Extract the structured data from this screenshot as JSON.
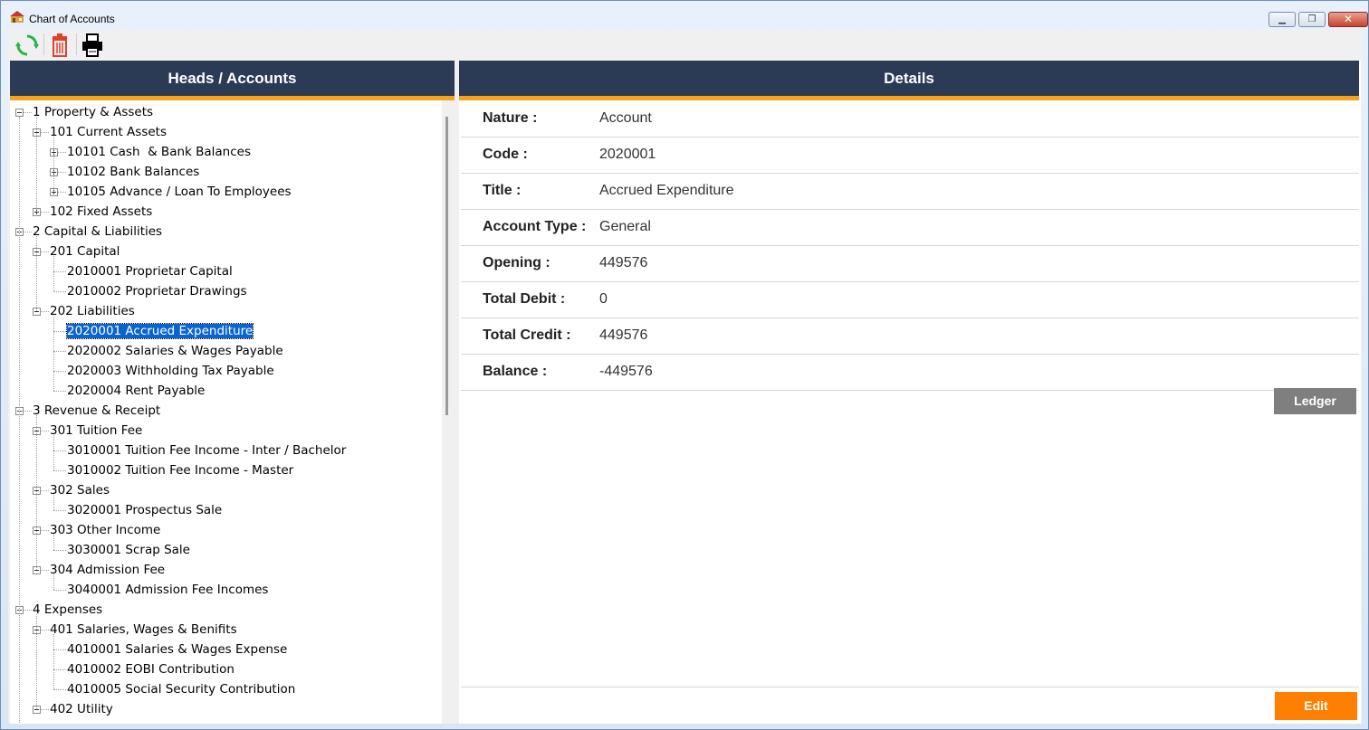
{
  "window": {
    "title": "Chart of Accounts"
  },
  "toolbar": {
    "refresh_icon": "refresh-icon",
    "delete_icon": "trash-icon",
    "print_icon": "printer-icon"
  },
  "colors": {
    "header_bg": "#2b3a55",
    "accent": "#f7a21b",
    "selected": "#0a64d0",
    "edit_button": "#ff7f00",
    "ledger_button": "#7f7f7f"
  },
  "left_panel": {
    "header": "Heads / Accounts",
    "tree": [
      {
        "level": 0,
        "label": "1 Property & Assets",
        "toggle": "minus"
      },
      {
        "level": 1,
        "label": "101 Current Assets",
        "toggle": "minus"
      },
      {
        "level": 2,
        "label": "10101 Cash  & Bank Balances",
        "toggle": "plus"
      },
      {
        "level": 2,
        "label": "10102 Bank Balances",
        "toggle": "plus"
      },
      {
        "level": 2,
        "label": "10105 Advance / Loan To Employees",
        "toggle": "plus"
      },
      {
        "level": 1,
        "label": "102 Fixed Assets",
        "toggle": "plus"
      },
      {
        "level": 0,
        "label": "2 Capital & Liabilities",
        "toggle": "minus"
      },
      {
        "level": 1,
        "label": "201 Capital",
        "toggle": "minus"
      },
      {
        "level": 2,
        "label": "2010001 Proprietar Capital",
        "toggle": "none"
      },
      {
        "level": 2,
        "label": "2010002 Proprietar Drawings",
        "toggle": "none"
      },
      {
        "level": 1,
        "label": "202 Liabilities",
        "toggle": "minus"
      },
      {
        "level": 2,
        "label": "2020001 Accrued Expenditure",
        "toggle": "none",
        "selected": true
      },
      {
        "level": 2,
        "label": "2020002 Salaries & Wages Payable",
        "toggle": "none"
      },
      {
        "level": 2,
        "label": "2020003 Withholding Tax Payable",
        "toggle": "none"
      },
      {
        "level": 2,
        "label": "2020004 Rent Payable",
        "toggle": "none"
      },
      {
        "level": 0,
        "label": "3 Revenue & Receipt",
        "toggle": "minus"
      },
      {
        "level": 1,
        "label": "301 Tuition Fee",
        "toggle": "minus"
      },
      {
        "level": 2,
        "label": "3010001 Tuition Fee Income - Inter / Bachelor",
        "toggle": "none"
      },
      {
        "level": 2,
        "label": "3010002 Tuition Fee Income - Master",
        "toggle": "none"
      },
      {
        "level": 1,
        "label": "302 Sales",
        "toggle": "minus"
      },
      {
        "level": 2,
        "label": "3020001 Prospectus Sale",
        "toggle": "none"
      },
      {
        "level": 1,
        "label": "303 Other Income",
        "toggle": "minus"
      },
      {
        "level": 2,
        "label": "3030001 Scrap Sale",
        "toggle": "none"
      },
      {
        "level": 1,
        "label": "304 Admission Fee",
        "toggle": "minus"
      },
      {
        "level": 2,
        "label": "3040001 Admission Fee Incomes",
        "toggle": "none"
      },
      {
        "level": 0,
        "label": "4 Expenses",
        "toggle": "minus"
      },
      {
        "level": 1,
        "label": "401 Salaries, Wages & Benifits",
        "toggle": "minus"
      },
      {
        "level": 2,
        "label": "4010001 Salaries & Wages Expense",
        "toggle": "none"
      },
      {
        "level": 2,
        "label": "4010002 EOBI Contribution",
        "toggle": "none"
      },
      {
        "level": 2,
        "label": "4010005 Social Security Contribution",
        "toggle": "none"
      },
      {
        "level": 1,
        "label": "402 Utility",
        "toggle": "minus"
      }
    ]
  },
  "right_panel": {
    "header": "Details",
    "fields": [
      {
        "label": "Nature :",
        "value": "Account"
      },
      {
        "label": "Code :",
        "value": "2020001"
      },
      {
        "label": "Title :",
        "value": "Accrued Expenditure"
      },
      {
        "label": "Account Type :",
        "value": "General"
      },
      {
        "label": "Opening :",
        "value": "449576"
      },
      {
        "label": "Total Debit :",
        "value": "0"
      },
      {
        "label": "Total Credit :",
        "value": "449576"
      },
      {
        "label": "Balance :",
        "value": "-449576"
      }
    ],
    "ledger_button": "Ledger",
    "edit_button": "Edit"
  }
}
